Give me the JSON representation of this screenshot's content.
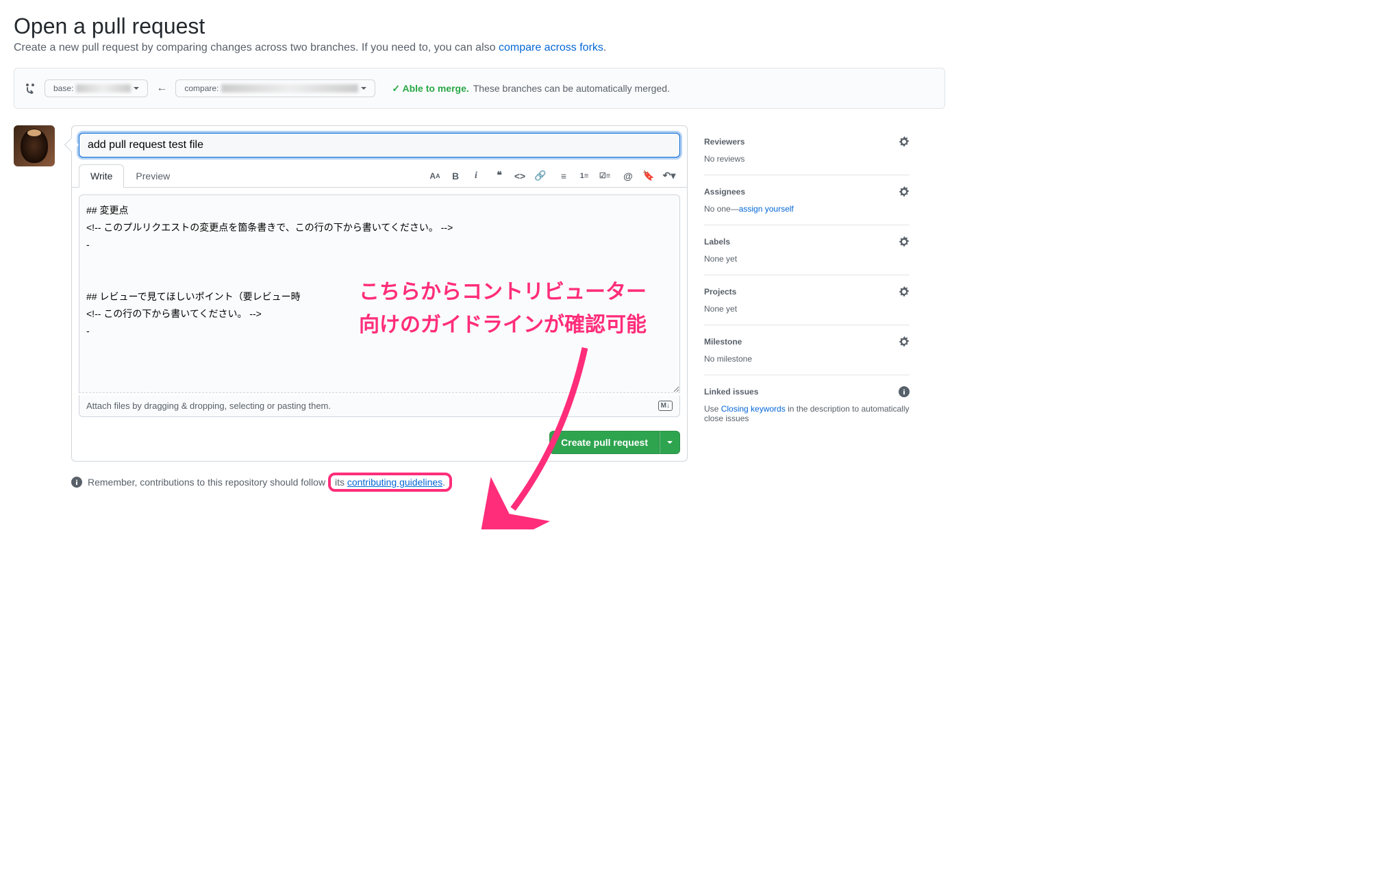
{
  "header": {
    "title": "Open a pull request",
    "subhead_before": "Create a new pull request by comparing changes across two branches. If you need to, you can also ",
    "subhead_link": "compare across forks",
    "subhead_after": "."
  },
  "compare": {
    "base_label": "base:",
    "compare_label": "compare:",
    "merge_ok": "Able to merge.",
    "merge_msg": "These branches can be automatically merged."
  },
  "form": {
    "title_value": "add pull request test file",
    "tab_write": "Write",
    "tab_preview": "Preview",
    "body_value": "## 変更点\n<!-- このプルリクエストの変更点を箇条書きで、この行の下から書いてください。 -->\n-\n\n\n## レビューで見てほしいポイント（要レビュー時\n<!-- この行の下から書いてください。 -->\n-\n",
    "attach_hint": "Attach files by dragging & dropping, selecting or pasting them.",
    "submit_label": "Create pull request"
  },
  "footer": {
    "before": "Remember, contributions to this repository should follow ",
    "its": "its ",
    "link": "contributing guidelines",
    "after": "."
  },
  "sidebar": {
    "reviewers": {
      "title": "Reviewers",
      "value": "No reviews"
    },
    "assignees": {
      "title": "Assignees",
      "value": "No one—",
      "self": "assign yourself"
    },
    "labels": {
      "title": "Labels",
      "value": "None yet"
    },
    "projects": {
      "title": "Projects",
      "value": "None yet"
    },
    "milestone": {
      "title": "Milestone",
      "value": "No milestone"
    },
    "linked": {
      "title": "Linked issues",
      "before": "Use ",
      "link": "Closing keywords",
      "after": " in the description to automatically close issues"
    }
  },
  "annotation": {
    "line1": "こちらからコントリビューター",
    "line2": "向けのガイドラインが確認可能"
  },
  "md_badge": "M↓"
}
